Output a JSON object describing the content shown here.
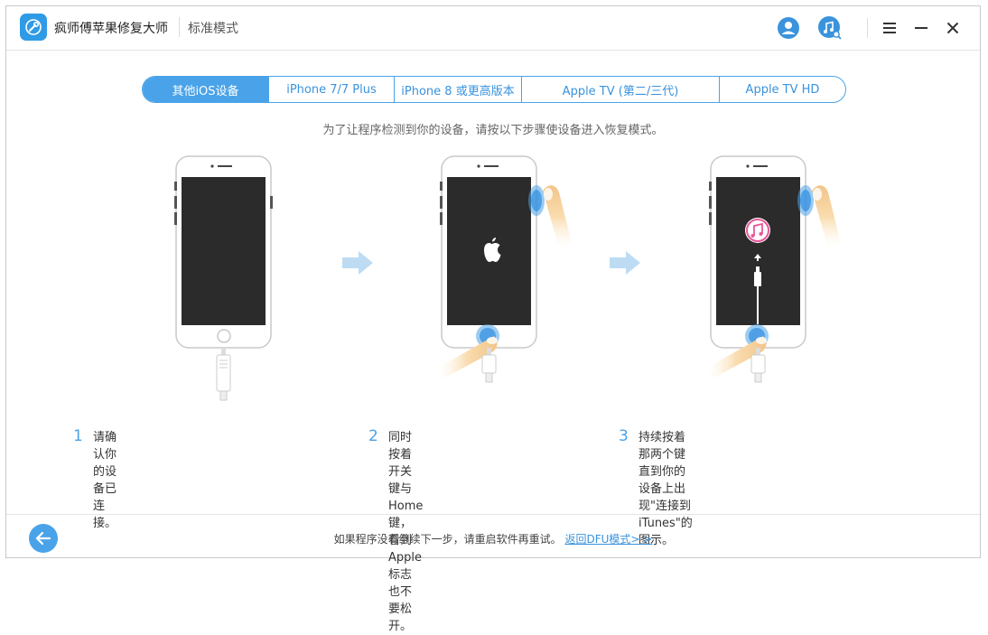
{
  "app": {
    "name": "疯师傅苹果修复大师",
    "mode": "标准模式"
  },
  "titlebar": {
    "icons": [
      "account-icon",
      "music-search-icon",
      "menu-icon",
      "minimize-icon",
      "close-icon"
    ]
  },
  "tabs": [
    {
      "label": "其他iOS设备",
      "active": true
    },
    {
      "label": "iPhone 7/7 Plus",
      "active": false
    },
    {
      "label": "iPhone 8 或更高版本",
      "active": false
    },
    {
      "label": "Apple TV (第二/三代)",
      "active": false
    },
    {
      "label": "Apple TV HD",
      "active": false
    }
  ],
  "instruction": "为了让程序检测到你的设备，请按以下步骤使设备进入恢复模式。",
  "steps": [
    {
      "num": "1",
      "line1": "请确认你的设备已连接。",
      "line2": ""
    },
    {
      "num": "2",
      "line1": "同时按着开关键与Home键，看到Apple",
      "line2": "标志也不要松开。"
    },
    {
      "num": "3",
      "line1": "持续按着那两个键直到你的设备上出现\"连接到",
      "line2": "iTunes\"的图示。"
    }
  ],
  "footer": {
    "text": "如果程序没有继续下一步，请重启软件再重试。",
    "link": "返回DFU模式> >"
  },
  "colors": {
    "accent": "#4aa3e8",
    "phone_screen": "#2b2b2b",
    "finger": "#f6c98e"
  }
}
